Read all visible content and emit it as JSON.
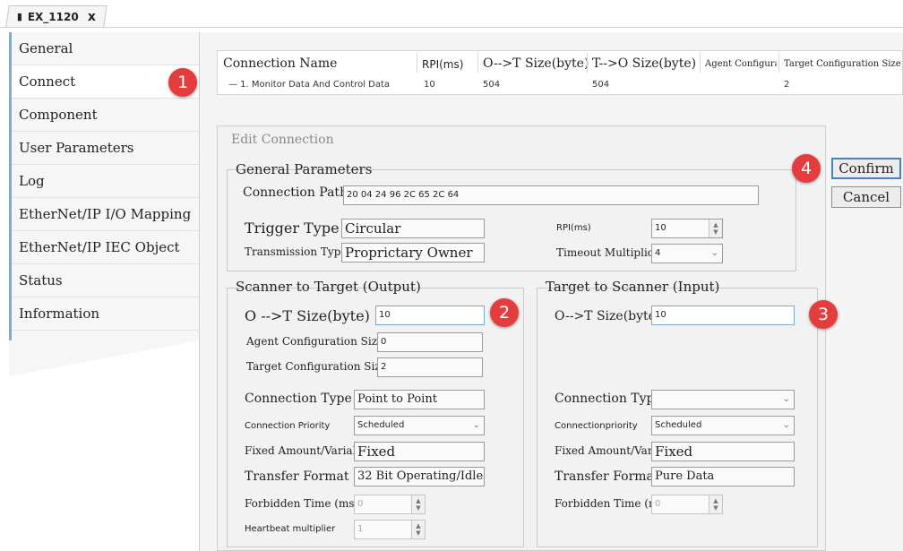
{
  "tab": {
    "title": "EX_1120",
    "close": "x",
    "icon": "device-icon"
  },
  "sidebar": {
    "items": [
      {
        "label": "General"
      },
      {
        "label": "Connect"
      },
      {
        "label": "Component"
      },
      {
        "label": "User Parameters"
      },
      {
        "label": "Log"
      },
      {
        "label": "EtherNet/IP I/O Mapping"
      },
      {
        "label": "EtherNet/IP IEC Object"
      },
      {
        "label": "Status"
      },
      {
        "label": "Information"
      }
    ],
    "active": "Connect"
  },
  "connections_table": {
    "headers": [
      "Connection Name",
      "RPI(ms)",
      "O-->T Size(byte)",
      "T-->O Size(byte)",
      "Agent Configuration...",
      "Target Configuration Size (byte)"
    ],
    "rows": [
      [
        "— 1. Monitor Data And Control Data",
        "10",
        "504",
        "504",
        "",
        "2"
      ]
    ]
  },
  "dialog": {
    "title": "Edit Connection",
    "general": {
      "title": "General Parameters",
      "connection_path_label": "Connection Path",
      "connection_path": "20 04 24 96 2C 65 2C 64",
      "trigger_type_label": "Trigger Type",
      "trigger_type": "Circular",
      "transmission_type_label": "Transmission Type",
      "transmission_type": "Proprictary Owner",
      "rpi_label": "RPI(ms)",
      "rpi": "10",
      "timeout_label": "Timeout Multiplication",
      "timeout": "4"
    },
    "output": {
      "title": "Scanner to Target (Output)",
      "ot_size_label": "O -->T Size(byte)",
      "ot_size": "10",
      "agent_cfg_label": "Agent Configuration Size",
      "agent_cfg": "0",
      "target_cfg_label": "Target Configuration Size",
      "target_cfg": "2",
      "conn_type_label": "Connection Type",
      "conn_type": "Point to Point",
      "priority_label": "Connection Priority",
      "priority": "Scheduled",
      "fixed_label": "Fixed Amount/Variable",
      "fixed": "Fixed",
      "transfer_label": "Transfer Format",
      "transfer": "32 Bit Operating/Idle",
      "forbidden_label": "Forbidden Time (ms)",
      "forbidden": "0",
      "heartbeat_label": "Heartbeat multiplier",
      "heartbeat": "1"
    },
    "input": {
      "title": "Target to Scanner (Input)",
      "ot_size_label": "O-->T Size(byte)",
      "ot_size": "10",
      "conn_type_label": "Connection Type",
      "conn_type": "",
      "priority_label": "Connectionpriority",
      "priority": "Scheduled",
      "fixed_label": "Fixed Amount/Variable",
      "fixed": "Fixed",
      "transfer_label": "Transfer Format",
      "transfer": "Pure Data",
      "forbidden_label": "Forbidden Time (ms)",
      "forbidden": "0"
    },
    "buttons": {
      "confirm": "Confirm",
      "cancel": "Cancel"
    }
  },
  "markers": [
    "1",
    "2",
    "3",
    "4"
  ],
  "colors": {
    "marker": "#e53d3d",
    "active_border": "#7aa7d6",
    "sidebar_accent": "#8da7c7"
  }
}
